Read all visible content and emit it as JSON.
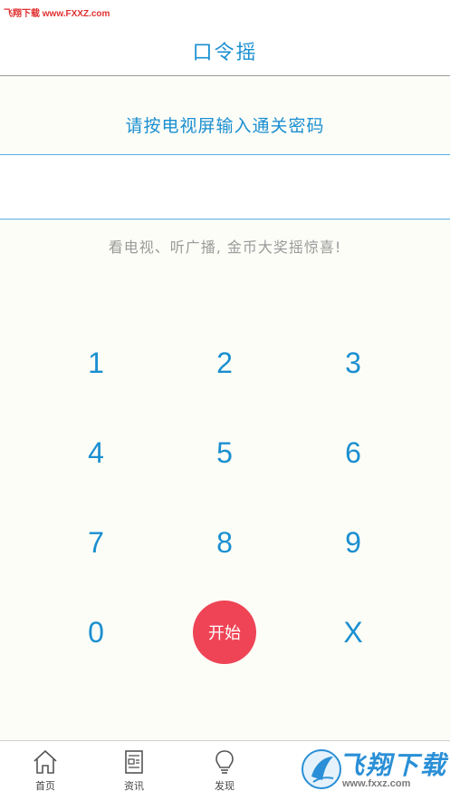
{
  "watermark": "飞翔下载 www.FXXZ.com",
  "header": {
    "title": "口令摇"
  },
  "prompt": "请按电视屏输入通关密码",
  "input": {
    "value": ""
  },
  "slogan": "看电视、听广播, 金币大奖摇惊喜!",
  "keypad": {
    "k1": "1",
    "k2": "2",
    "k3": "3",
    "k4": "4",
    "k5": "5",
    "k6": "6",
    "k7": "7",
    "k8": "8",
    "k9": "9",
    "k0": "0",
    "start": "开始",
    "clear": "X"
  },
  "tabs": [
    {
      "label": "首页",
      "icon": "home-icon"
    },
    {
      "label": "资讯",
      "icon": "news-icon"
    },
    {
      "label": "发现",
      "icon": "lightbulb-icon"
    }
  ],
  "brand": {
    "name": "飞翔下载",
    "url": "www.fxxz.com"
  },
  "colors": {
    "accent": "#1a8fd0",
    "start": "#ee4455",
    "muted": "#9a9a9a"
  }
}
